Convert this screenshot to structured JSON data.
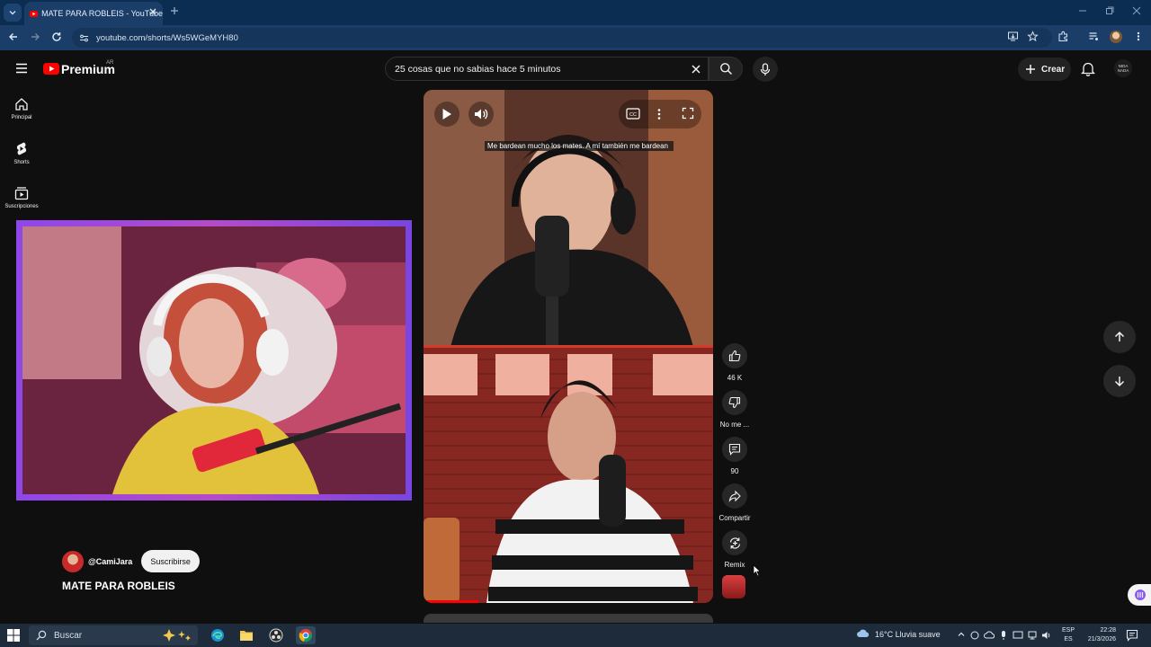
{
  "browser": {
    "tab_title": "MATE PARA ROBLEIS - YouTube",
    "url": "youtube.com/shorts/Ws5WGeMYH80"
  },
  "header": {
    "logo_text": "Premium",
    "region": "AR",
    "search_value": "25 cosas que no sabias hace 5 minutos",
    "create_label": "Crear",
    "account_badge": "NIDA NADA"
  },
  "guide": {
    "items": [
      {
        "label": "Principal",
        "icon": "home-icon"
      },
      {
        "label": "Shorts",
        "icon": "shorts-icon"
      },
      {
        "label": "Suscripciones",
        "icon": "subscriptions-icon"
      }
    ]
  },
  "player": {
    "caption": "Me bardean mucho los mates. A mí también me bardean",
    "progress": 0.19
  },
  "actions": {
    "likes": "46 K",
    "dislike_label": "No me ...",
    "comments": "90",
    "share_label": "Compartir",
    "remix_label": "Remix"
  },
  "short": {
    "channel": "@CamiJara",
    "subscribe_label": "Suscribirse",
    "title": "MATE PARA ROBLEIS"
  },
  "taskbar": {
    "search_placeholder": "Buscar",
    "weather": "16°C  Lluvia suave",
    "lang_top": "ESP",
    "lang_bottom": "ES",
    "time": "22:28",
    "date": "21/3/2026"
  },
  "colors": {
    "yt_red": "#ff0000",
    "background": "#0f0f0f",
    "webcam_border": "#9a3ad8"
  }
}
